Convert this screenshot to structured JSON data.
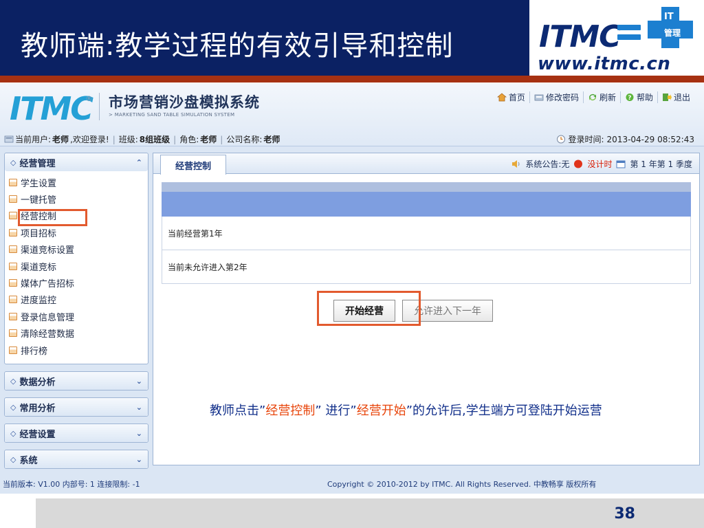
{
  "slide": {
    "title": "教师端:教学过程的有效引导和控制",
    "logo_text": "ITMC",
    "logo_sub": "www.itmc.cn",
    "logo_badge": "IT 管理",
    "page_number": "38"
  },
  "app": {
    "logo": "ITMC",
    "logo_mark": "®",
    "title": "市场营销沙盘模拟系统",
    "subtitle": "> MARKETING SAND TABLE SIMULATION SYSTEM",
    "toplinks": [
      {
        "label": "首页",
        "icon": "home-icon"
      },
      {
        "label": "修改密码",
        "icon": "password-icon"
      },
      {
        "label": "刷新",
        "icon": "refresh-icon"
      },
      {
        "label": "帮助",
        "icon": "help-icon"
      },
      {
        "label": "退出",
        "icon": "exit-icon"
      }
    ],
    "userbar": {
      "user_label": "当前用户:",
      "user_value": "老师",
      "welcome": ",欢迎登录!",
      "class_label": "班级:",
      "class_value": "8组班级",
      "role_label": "角色:",
      "role_value": "老师",
      "company_label": "公司名称:",
      "company_value": "老师",
      "login_time_label": "登录时间:",
      "login_time_value": "2013-04-29 08:52:43"
    },
    "sidebar": {
      "main_section": "经营管理",
      "items": [
        "学生设置",
        "一键托管",
        "经营控制",
        "项目招标",
        "渠道竞标设置",
        "渠道竞标",
        "媒体广告招标",
        "进度监控",
        "登录信息管理",
        "清除经营数据",
        "排行榜"
      ],
      "collapsed_sections": [
        "数据分析",
        "常用分析",
        "经营设置",
        "系统"
      ]
    },
    "tab": {
      "active": "经营控制",
      "announcement": "系统公告:无",
      "timer": "没计时",
      "period": "第 1 年第 1 季度"
    },
    "grid": {
      "rows": [
        "当前经营第1年",
        "当前未允许进入第2年"
      ]
    },
    "buttons": {
      "start": "开始经营",
      "next_year": "允许进入下一年"
    },
    "note": {
      "part1": "教师点击”",
      "hl1": "经营控制",
      "part2": "” 进行”",
      "hl2": "经营开始",
      "part3": "”的允许后,学生端方可登陆开始运营"
    },
    "footer": {
      "left": "当前版本: V1.00 内部号: 1 连接限制: -1",
      "right": "Copyright © 2010-2012 by ITMC. All Rights Reserved. 中教畅享 版权所有"
    }
  },
  "colors": {
    "title_band": "#0b2163",
    "accent_red": "#a63112",
    "highlight": "#e25a2e",
    "link_blue": "#24a0d6"
  }
}
